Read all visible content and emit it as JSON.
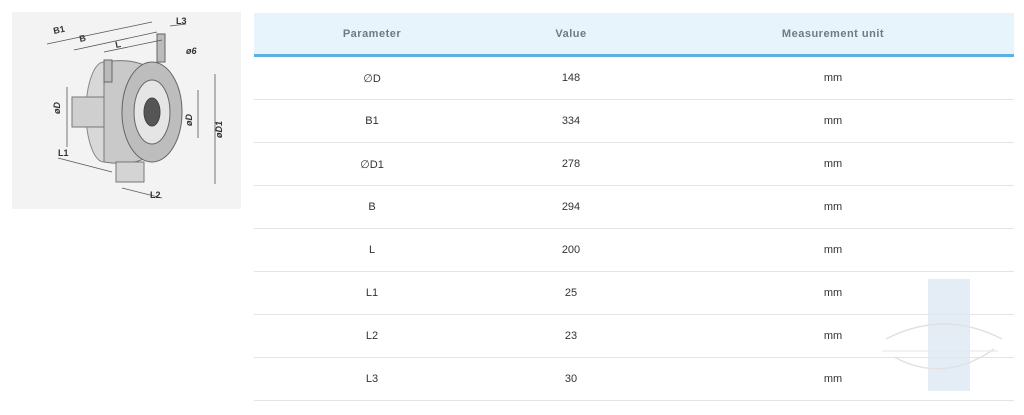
{
  "diagram": {
    "labels": {
      "b1": "B1",
      "b": "B",
      "l": "L",
      "l3": "L3",
      "hole": "ø6",
      "d_left": "øD",
      "d_mid": "øD",
      "d1": "øD1",
      "l1": "L1",
      "l2": "L2"
    }
  },
  "table": {
    "headers": {
      "parameter": "Parameter",
      "value": "Value",
      "unit": "Measurement unit"
    },
    "rows": [
      {
        "parameter": "∅D",
        "value": "148",
        "unit": "mm"
      },
      {
        "parameter": "B1",
        "value": "334",
        "unit": "mm"
      },
      {
        "parameter": "∅D1",
        "value": "278",
        "unit": "mm"
      },
      {
        "parameter": "B",
        "value": "294",
        "unit": "mm"
      },
      {
        "parameter": "L",
        "value": "200",
        "unit": "mm"
      },
      {
        "parameter": "L1",
        "value": "25",
        "unit": "mm"
      },
      {
        "parameter": "L2",
        "value": "23",
        "unit": "mm"
      },
      {
        "parameter": "L3",
        "value": "30",
        "unit": "mm"
      }
    ]
  },
  "colors": {
    "header_bg": "#e8f4fb",
    "header_border": "#5ab1e2",
    "header_text": "#6c7b86",
    "row_border": "#e4e4e4"
  },
  "watermark": {
    "icon": "watermark-logo-icon"
  }
}
